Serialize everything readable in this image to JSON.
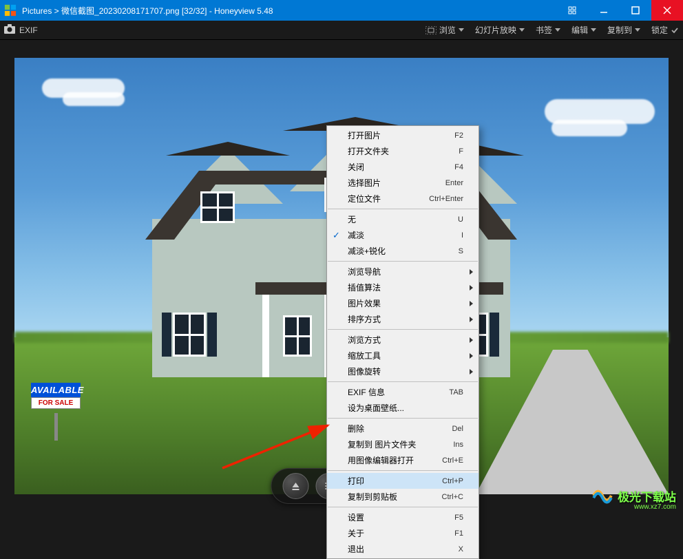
{
  "title": {
    "path": "Pictures > 微信截图_20230208171707.png [32/32] - Honeyview 5.48"
  },
  "toolbar": {
    "exif": "EXIF",
    "menu": {
      "browse": "浏览",
      "slideshow": "幻灯片放映",
      "bookmark": "书签",
      "edit": "编辑",
      "copyto": "复制到",
      "lock": "锁定"
    }
  },
  "sign": {
    "available": "AVAILABLE",
    "forsale": "FOR SALE"
  },
  "contextMenu": {
    "groups": [
      [
        {
          "label": "打开图片",
          "shortcut": "F2"
        },
        {
          "label": "打开文件夹",
          "shortcut": "F"
        },
        {
          "label": "关闭",
          "shortcut": "F4"
        },
        {
          "label": "选择图片",
          "shortcut": "Enter"
        },
        {
          "label": "定位文件",
          "shortcut": "Ctrl+Enter"
        }
      ],
      [
        {
          "label": "无",
          "shortcut": "U"
        },
        {
          "label": "减淡",
          "shortcut": "I",
          "checked": true
        },
        {
          "label": "减淡+锐化",
          "shortcut": "S"
        }
      ],
      [
        {
          "label": "浏览导航",
          "submenu": true
        },
        {
          "label": "插值算法",
          "submenu": true
        },
        {
          "label": "图片效果",
          "submenu": true
        },
        {
          "label": "排序方式",
          "submenu": true
        }
      ],
      [
        {
          "label": "浏览方式",
          "submenu": true
        },
        {
          "label": "缩放工具",
          "submenu": true
        },
        {
          "label": "图像旋转",
          "submenu": true
        }
      ],
      [
        {
          "label": "EXIF 信息",
          "shortcut": "TAB"
        },
        {
          "label": "设为桌面壁纸..."
        }
      ],
      [
        {
          "label": "删除",
          "shortcut": "Del"
        },
        {
          "label": "复制到 图片文件夹",
          "shortcut": "Ins"
        },
        {
          "label": "用图像编辑器打开",
          "shortcut": "Ctrl+E"
        }
      ],
      [
        {
          "label": "打印",
          "shortcut": "Ctrl+P",
          "highlighted": true
        },
        {
          "label": "复制到剪贴板",
          "shortcut": "Ctrl+C"
        }
      ],
      [
        {
          "label": "设置",
          "shortcut": "F5"
        },
        {
          "label": "关于",
          "shortcut": "F1"
        },
        {
          "label": "退出",
          "shortcut": "X"
        }
      ]
    ]
  },
  "watermark": {
    "text": "极光下载站",
    "url": "www.xz7.com"
  }
}
